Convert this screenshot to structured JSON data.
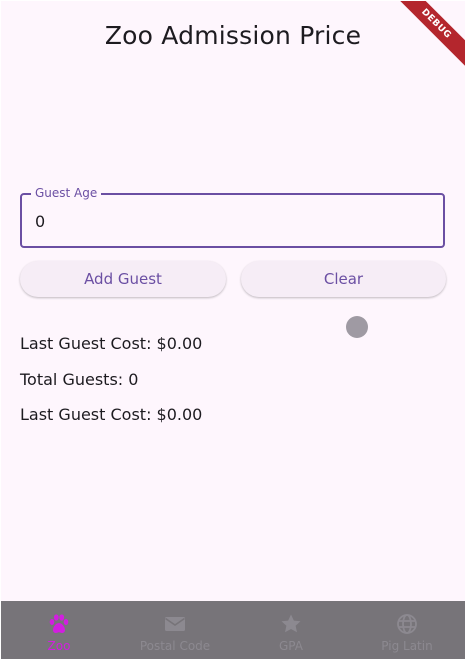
{
  "app_bar": {
    "title": "Zoo Admission Price",
    "debug_banner": "DEBUG"
  },
  "form": {
    "age_label": "Guest Age",
    "age_value": "0"
  },
  "buttons": {
    "add_guest": "Add Guest",
    "clear": "Clear"
  },
  "stats": {
    "last_guest_cost_1": "Last Guest Cost: $0.00",
    "total_guests": "Total Guests: 0",
    "last_guest_cost_2": "Last Guest Cost: $0.00"
  },
  "bottom_nav": {
    "items": [
      {
        "label": "Zoo",
        "icon": "paw-icon",
        "active": true
      },
      {
        "label": "Postal Code",
        "icon": "mail-icon",
        "active": false
      },
      {
        "label": "GPA",
        "icon": "star-icon",
        "active": false
      },
      {
        "label": "Pig Latin",
        "icon": "globe-icon",
        "active": false
      }
    ]
  },
  "colors": {
    "background": "#fef6fd",
    "primary": "#6b4fa3",
    "nav_active": "#d21ee0",
    "nav_background": "#777479"
  }
}
